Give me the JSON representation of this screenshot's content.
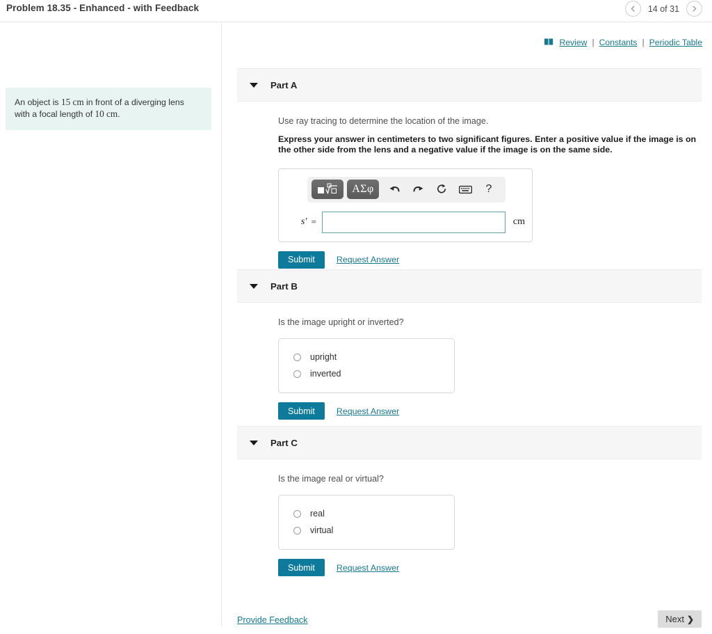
{
  "header": {
    "title": "Problem 18.35 - Enhanced - with Feedback",
    "pager": {
      "prev_icon": "chevron-left-icon",
      "next_icon": "chevron-right-icon",
      "count_label": "14 of 31"
    }
  },
  "toplinks": {
    "review_icon": "book-icon",
    "review": " Review",
    "sep1": "|",
    "constants": "Constants",
    "sep2": "|",
    "periodic_table": "Periodic Table"
  },
  "problem": {
    "text_a": "An object is ",
    "value_1": "15 cm",
    "text_b": " in front of a diverging lens with a focal length of ",
    "value_2": "10 cm",
    "text_c": "."
  },
  "mathbar": {
    "template_icon": "math-template-icon",
    "greek_label": "ΑΣφ",
    "undo_icon": "undo-icon",
    "redo_icon": "redo-icon",
    "reset_icon": "reset-icon",
    "keyboard_icon": "keyboard-icon",
    "help_label": "?"
  },
  "parts": [
    {
      "id": "a",
      "title": "Part A",
      "caret_icon": "caret-down-icon",
      "prompt": "Use ray tracing to determine the location of the image.",
      "instruction": "Express your answer in centimeters to two significant figures. Enter a positive value if the image is on the other side from the lens and a negative value if the image is on the same side.",
      "input": {
        "variable": "s′",
        "equals": "=",
        "value": "",
        "placeholder": "",
        "unit": "cm"
      },
      "submit_label": "Submit",
      "request_label": "Request Answer"
    },
    {
      "id": "b",
      "title": "Part B",
      "caret_icon": "caret-down-icon",
      "prompt": "Is the image upright or inverted?",
      "options": [
        {
          "label": "upright",
          "selected": false
        },
        {
          "label": "inverted",
          "selected": false
        }
      ],
      "submit_label": "Submit",
      "request_label": "Request Answer"
    },
    {
      "id": "c",
      "title": "Part C",
      "caret_icon": "caret-down-icon",
      "prompt": "Is the image real or virtual?",
      "options": [
        {
          "label": "real",
          "selected": false
        },
        {
          "label": "virtual",
          "selected": false
        }
      ],
      "submit_label": "Submit",
      "request_label": "Request Answer"
    }
  ],
  "footer": {
    "provide_feedback": "Provide Feedback",
    "next_label": "Next",
    "next_chevron": "chevron-right-icon"
  },
  "colors": {
    "accent_teal": "#0f7b9c",
    "link_teal": "#16798e",
    "problem_bg": "#e8f4f2",
    "part_header_bg": "#f6f6f6",
    "next_btn_bg": "#dcdcdc"
  }
}
